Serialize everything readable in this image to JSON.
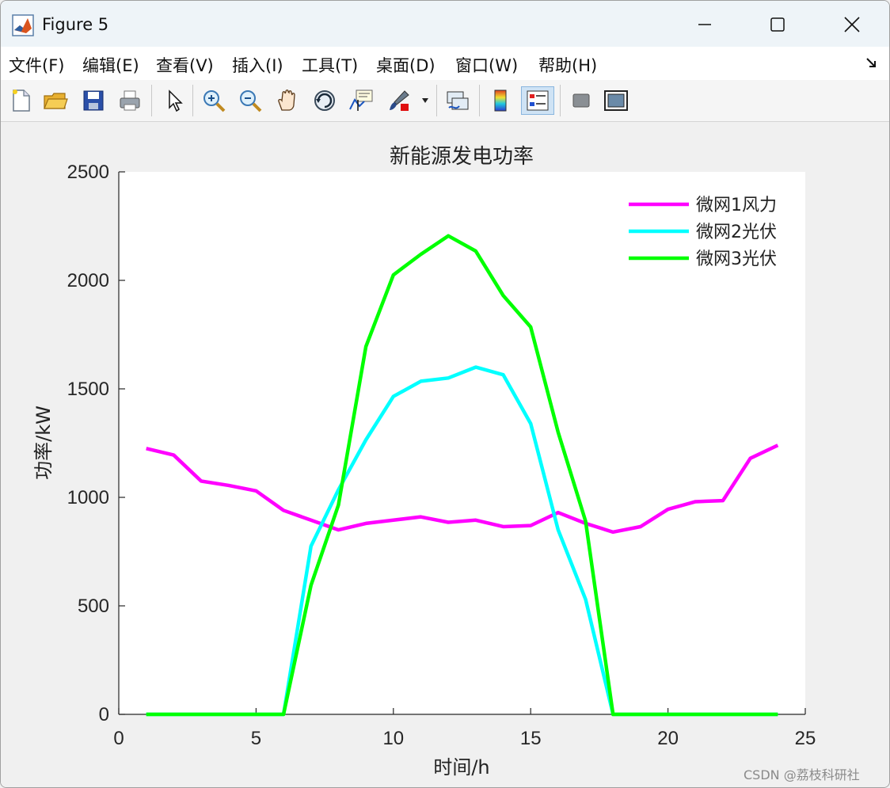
{
  "window": {
    "title": "Figure 5",
    "controls": {
      "minimize_icon": "minimize-icon",
      "maximize_icon": "maximize-icon",
      "close_icon": "close-icon"
    }
  },
  "menu": {
    "items": [
      {
        "label": "文件(F)"
      },
      {
        "label": "编辑(E)"
      },
      {
        "label": "查看(V)"
      },
      {
        "label": "插入(I)"
      },
      {
        "label": "工具(T)"
      },
      {
        "label": "桌面(D)"
      },
      {
        "label": "窗口(W)"
      },
      {
        "label": "帮助(H)"
      }
    ]
  },
  "toolbar": {
    "buttons": [
      {
        "icon": "new-figure-icon"
      },
      {
        "icon": "open-file-icon"
      },
      {
        "icon": "save-icon"
      },
      {
        "icon": "print-icon"
      },
      {
        "icon": "pointer-icon"
      },
      {
        "icon": "zoom-in-icon"
      },
      {
        "icon": "zoom-out-icon"
      },
      {
        "icon": "pan-hand-icon"
      },
      {
        "icon": "rotate-3d-icon"
      },
      {
        "icon": "data-cursor-icon"
      },
      {
        "icon": "brush-icon"
      },
      {
        "icon": "link-plot-icon"
      },
      {
        "icon": "colorbar-icon"
      },
      {
        "icon": "legend-icon",
        "active": true
      },
      {
        "icon": "hide-tools-icon"
      },
      {
        "icon": "dock-figure-icon"
      }
    ]
  },
  "chart_data": {
    "type": "line",
    "title": "新能源发电功率",
    "xlabel": "时间/h",
    "ylabel": "功率/kW",
    "xlim": [
      0,
      25
    ],
    "ylim": [
      0,
      2500
    ],
    "xticks": [
      "0",
      "5",
      "10",
      "15",
      "20",
      "25"
    ],
    "yticks": [
      "0",
      "500",
      "1000",
      "1500",
      "2000",
      "2500"
    ],
    "grid": false,
    "legend_position": "top-right",
    "x": [
      1,
      2,
      3,
      4,
      5,
      6,
      7,
      8,
      9,
      10,
      11,
      12,
      13,
      14,
      15,
      16,
      17,
      18,
      19,
      20,
      21,
      22,
      23,
      24
    ],
    "series": [
      {
        "name": "微网1风力",
        "color": "#ff00ff",
        "values": [
          1225,
          1195,
          1075,
          1055,
          1030,
          940,
          895,
          850,
          880,
          895,
          910,
          885,
          895,
          865,
          870,
          930,
          880,
          840,
          865,
          945,
          980,
          985,
          1180,
          1240
        ]
      },
      {
        "name": "微网2光伏",
        "color": "#00ffff",
        "values": [
          0,
          0,
          0,
          0,
          0,
          0,
          775,
          1035,
          1265,
          1465,
          1535,
          1550,
          1600,
          1565,
          1340,
          850,
          530,
          0,
          0,
          0,
          0,
          0,
          0,
          0
        ]
      },
      {
        "name": "微网3光伏",
        "color": "#00ff00",
        "values": [
          0,
          0,
          0,
          0,
          0,
          0,
          595,
          965,
          1695,
          2025,
          2120,
          2205,
          2135,
          1930,
          1785,
          1300,
          890,
          0,
          0,
          0,
          0,
          0,
          0,
          0
        ]
      }
    ]
  },
  "watermark": "CSDN @荔枝科研社"
}
